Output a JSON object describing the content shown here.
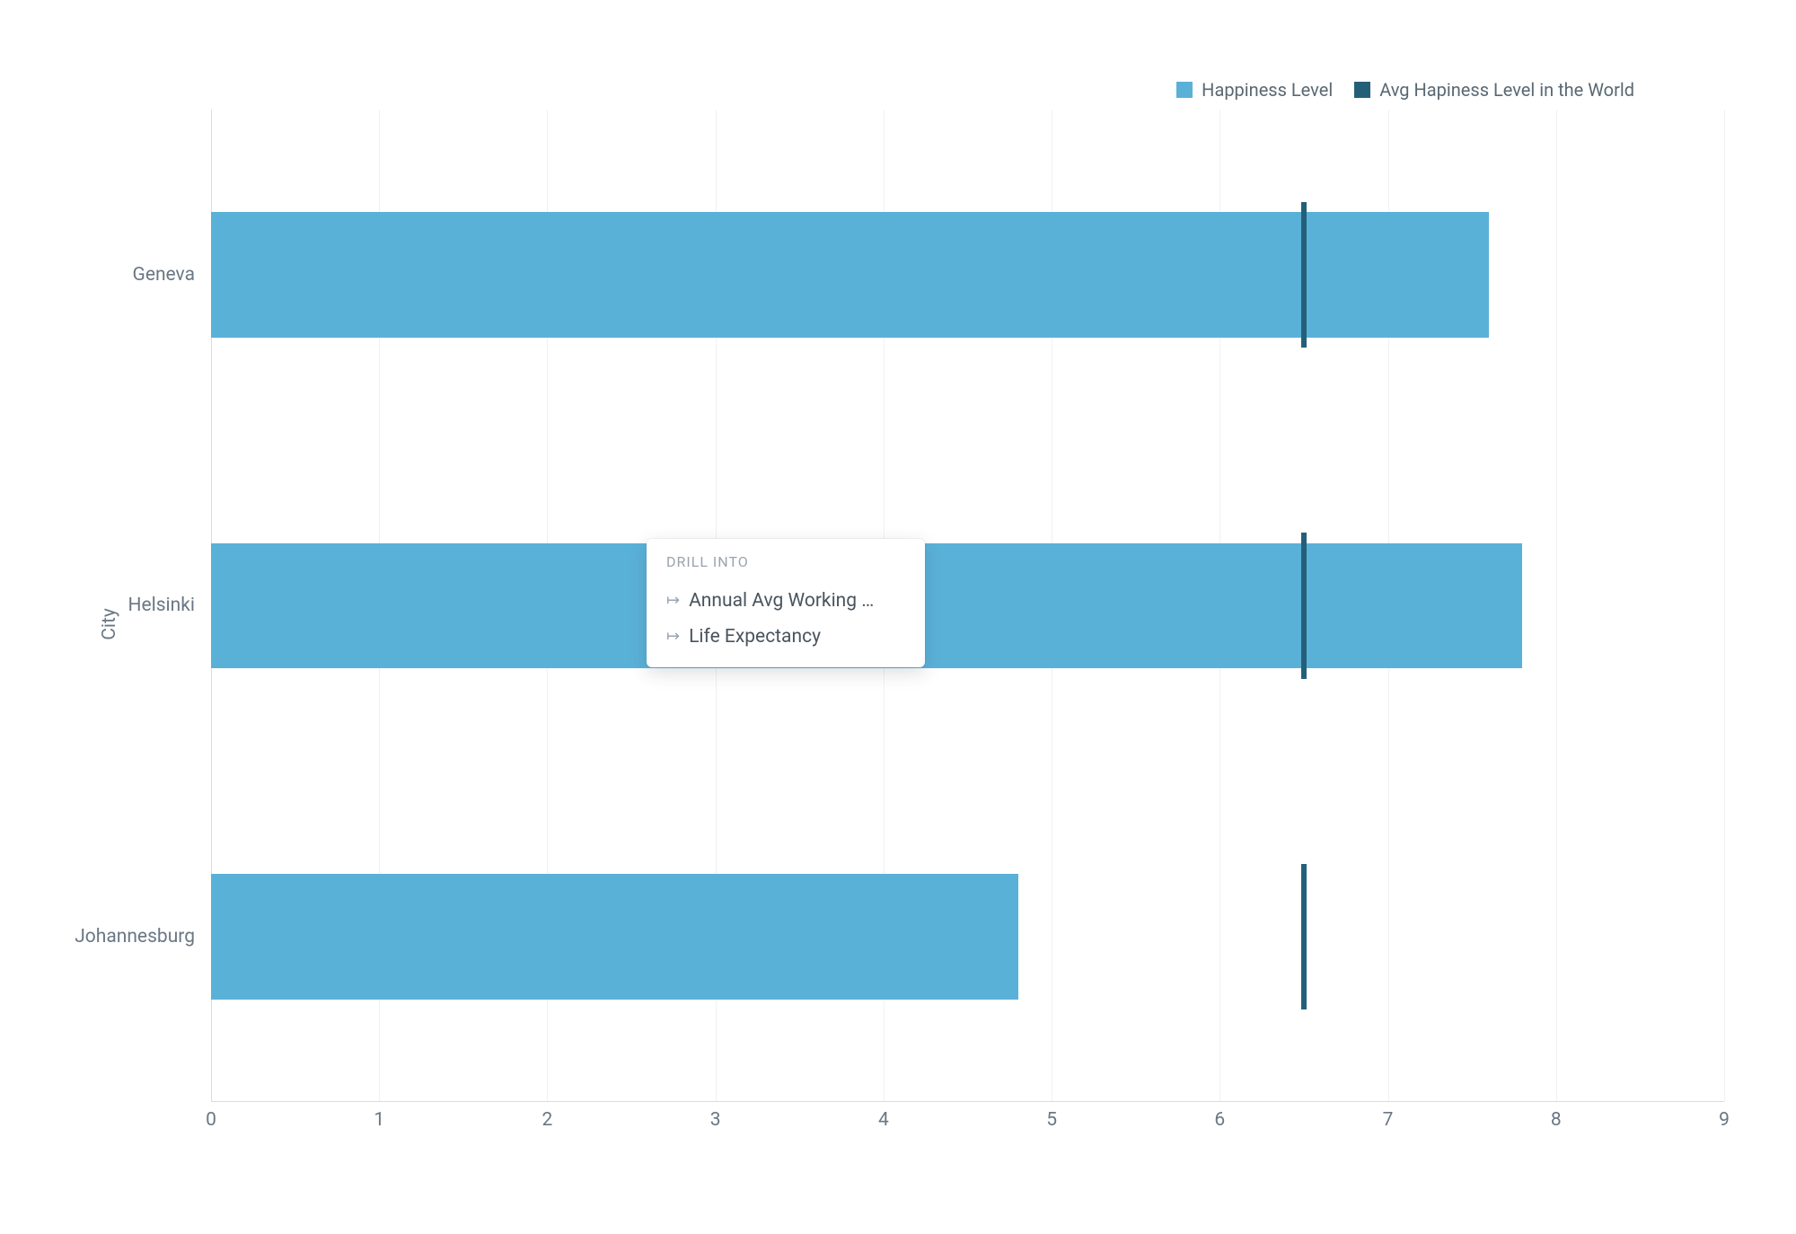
{
  "colors": {
    "bar": "#5ab1d8",
    "marker": "#245f7a"
  },
  "legend": {
    "series1": "Happiness Level",
    "series2": "Avg Hapiness Level in the World"
  },
  "ylabel": "City",
  "xticks": [
    "0",
    "1",
    "2",
    "3",
    "4",
    "5",
    "6",
    "7",
    "8",
    "9"
  ],
  "popover": {
    "title": "DRILL INTO",
    "items": [
      "Annual Avg Working …",
      "Life Expectancy"
    ]
  },
  "chart_data": {
    "type": "bar",
    "orientation": "horizontal",
    "xlabel": "",
    "ylabel": "City",
    "xlim": [
      0,
      9
    ],
    "categories": [
      "Geneva",
      "Helsinki",
      "Johannesburg"
    ],
    "series": [
      {
        "name": "Happiness Level",
        "values": [
          7.6,
          7.8,
          4.8
        ]
      },
      {
        "name": "Avg Hapiness Level in the World",
        "values": [
          6.5,
          6.5,
          6.5
        ]
      }
    ],
    "legend_position": "top-right",
    "grid": true
  }
}
